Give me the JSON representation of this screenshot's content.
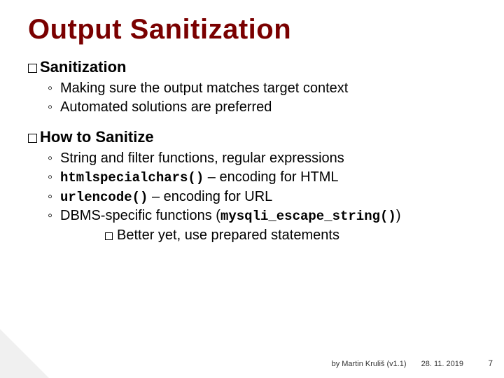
{
  "title": "Output Sanitization",
  "sections": [
    {
      "heading": "Sanitization",
      "items": [
        {
          "text": "Making sure the output matches target context"
        },
        {
          "text": "Automated solutions are preferred"
        }
      ]
    },
    {
      "heading": "How to Sanitize",
      "items": [
        {
          "text": "String and filter functions, regular expressions"
        },
        {
          "code": "htmlspecialchars()",
          "text_after": " – encoding for HTML"
        },
        {
          "code": "urlencode()",
          "text_after": " – encoding for URL"
        },
        {
          "text_before": "DBMS-specific functions (",
          "code": "mysqli_escape_string()",
          "text_after": ")",
          "subtext": "Better yet, use prepared statements"
        }
      ]
    }
  ],
  "footer": {
    "by": "by Martin Kruliš (v1.1)",
    "date": "28. 11. 2019",
    "page": "7"
  }
}
